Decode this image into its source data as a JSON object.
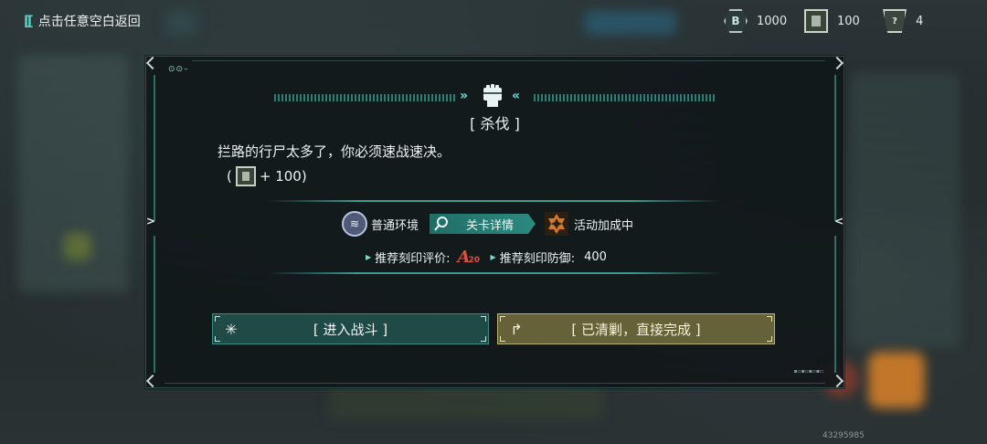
{
  "topbar": {
    "back_label": "点击任意空白返回",
    "resources": [
      {
        "icon": "b-coin-icon",
        "value": "1000"
      },
      {
        "icon": "card-icon",
        "value": "100"
      },
      {
        "icon": "badge-icon",
        "value": "4"
      }
    ]
  },
  "modal": {
    "title": "[ 杀伐 ]",
    "description": "拦路的行尸太多了，你必须速战速决。",
    "reward": {
      "open": "(",
      "value": "+ 100)"
    },
    "environment_label": "普通环境",
    "detail_button_label": "关卡详情",
    "event_label": "活动加成中",
    "recommend_rating_label": "推荐刻印评价:",
    "recommend_rating_grade": "A",
    "recommend_rating_number": "20",
    "recommend_defense_label": "推荐刻印防御:",
    "recommend_defense_value": "400",
    "fight_button_label": "[ 进入战斗 ]",
    "clear_button_label": "[ 已清剿，直接完成 ]"
  },
  "uid": "43295985",
  "colors": {
    "accent": "#3c9c92",
    "fight_button": "#214e4a",
    "clear_button": "#69653a",
    "grade": "#e84a3a"
  }
}
